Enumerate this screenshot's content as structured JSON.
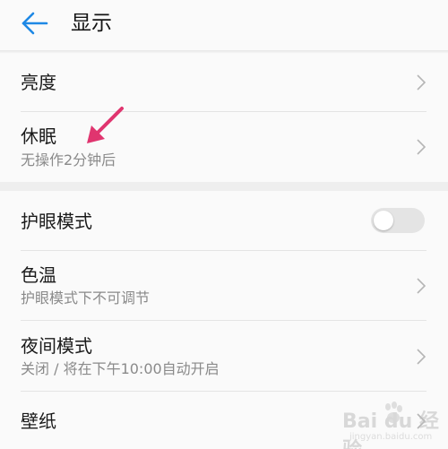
{
  "header": {
    "title": "显示"
  },
  "settings": {
    "brightness": {
      "label": "亮度"
    },
    "sleep": {
      "label": "休眠",
      "sub": "无操作2分钟后"
    },
    "eye_comfort": {
      "label": "护眼模式",
      "enabled": false
    },
    "color_temp": {
      "label": "色温",
      "sub": "护眼模式下不可调节"
    },
    "night_mode": {
      "label": "夜间模式",
      "sub": "关闭 / 将在下午10:00自动开启"
    },
    "wallpaper": {
      "label": "壁纸"
    }
  },
  "annotation": {
    "arrow_color": "#e0356f"
  },
  "watermark": {
    "brand": "Bai du 经验",
    "url": "jingyan.baidu.com"
  },
  "colors": {
    "accent": "#1e88e5",
    "toggle_off": "#e4e4e4"
  }
}
